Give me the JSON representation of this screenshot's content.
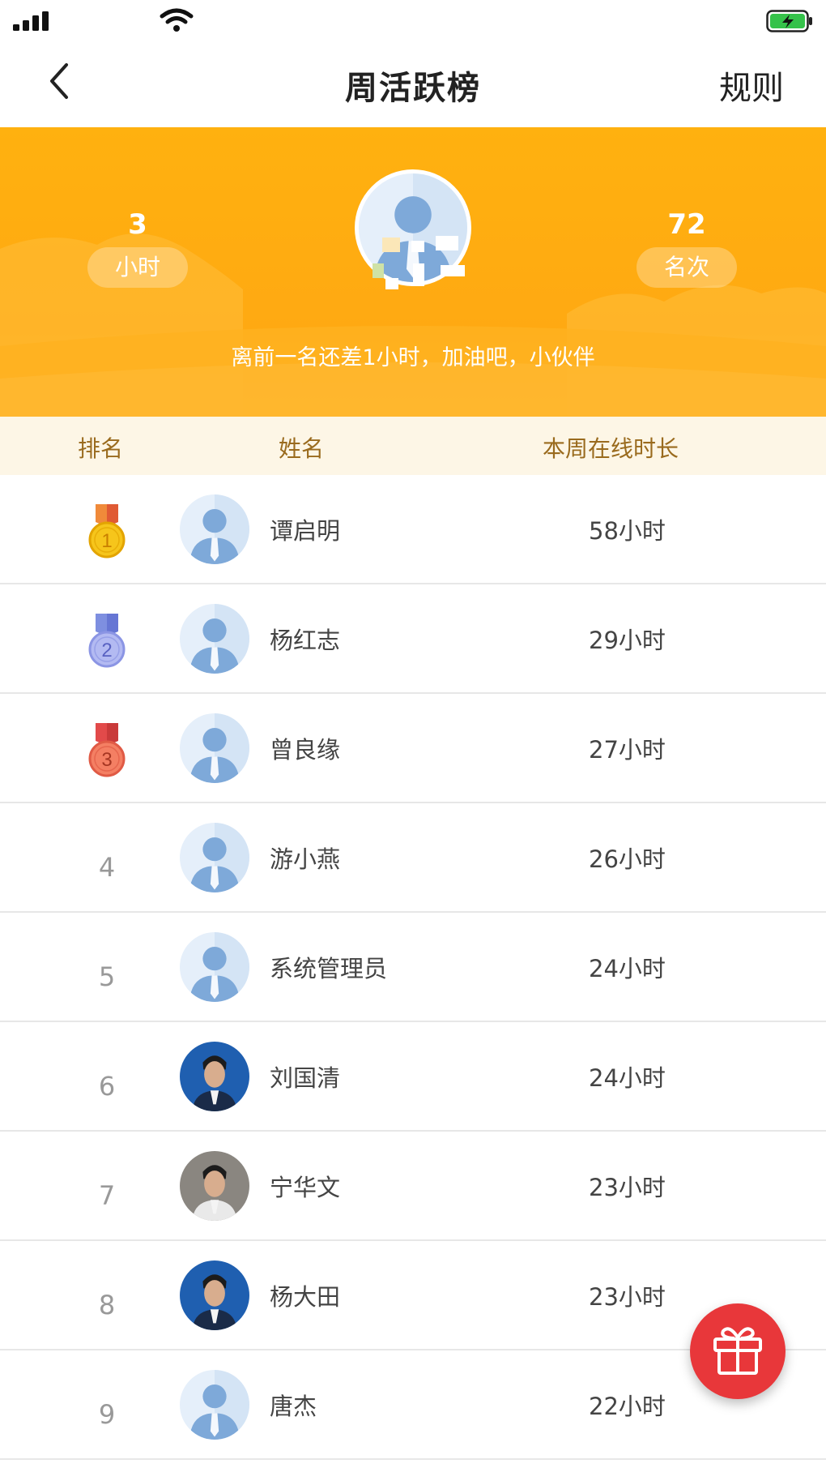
{
  "nav": {
    "title": "周活跃榜",
    "rules_label": "规则"
  },
  "banner": {
    "hours_value": "3",
    "hours_label": "小时",
    "rank_value": "72",
    "rank_label": "名次",
    "encourage": "离前一名还差1小时，加油吧，小伙伴"
  },
  "table": {
    "headers": {
      "rank": "排名",
      "name": "姓名",
      "time": "本周在线时长"
    },
    "rows": [
      {
        "rank": "1",
        "name": "谭启明",
        "time": "58小时",
        "medal": "gold",
        "avatar": "default"
      },
      {
        "rank": "2",
        "name": "杨红志",
        "time": "29小时",
        "medal": "silver",
        "avatar": "default"
      },
      {
        "rank": "3",
        "name": "曾良缘",
        "time": "27小时",
        "medal": "bronze",
        "avatar": "default"
      },
      {
        "rank": "4",
        "name": "游小燕",
        "time": "26小时",
        "medal": "",
        "avatar": "default"
      },
      {
        "rank": "5",
        "name": "系统管理员",
        "time": "24小时",
        "medal": "",
        "avatar": "default"
      },
      {
        "rank": "6",
        "name": "刘国清",
        "time": "24小时",
        "medal": "",
        "avatar": "photo-blue"
      },
      {
        "rank": "7",
        "name": "宁华文",
        "time": "23小时",
        "medal": "",
        "avatar": "photo-gray"
      },
      {
        "rank": "8",
        "name": "杨大田",
        "time": "23小时",
        "medal": "",
        "avatar": "photo-blue"
      },
      {
        "rank": "9",
        "name": "唐杰",
        "time": "22小时",
        "medal": "",
        "avatar": "default"
      }
    ]
  },
  "colors": {
    "banner": "#ffab12",
    "header_bg": "#fdf6e6",
    "header_text": "#9a6b1e",
    "fab": "#e8373a",
    "gold": "#f5c518",
    "silver": "#a9b2ee",
    "bronze": "#ef7760"
  },
  "icons": {
    "back": "chevron-left-icon",
    "fab": "gift-icon",
    "signal": "signal-icon",
    "wifi": "wifi-icon",
    "battery": "battery-charging-icon"
  }
}
